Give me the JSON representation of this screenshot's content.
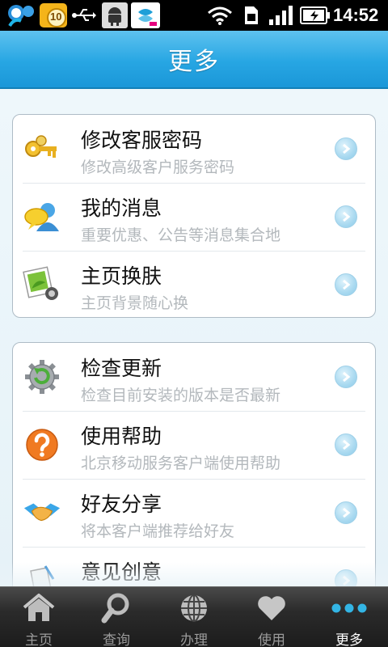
{
  "status_bar": {
    "time": "14:52",
    "badge_count": "10"
  },
  "header": {
    "title": "更多"
  },
  "groups": [
    {
      "items": [
        {
          "title": "修改客服密码",
          "subtitle": "修改高级客户服务密码",
          "icon": "key-icon"
        },
        {
          "title": "我的消息",
          "subtitle": "重要优惠、公告等消息集合地",
          "icon": "message-user-icon"
        },
        {
          "title": "主页换肤",
          "subtitle": "主页背景随心换",
          "icon": "skin-icon"
        }
      ]
    },
    {
      "items": [
        {
          "title": "检查更新",
          "subtitle": "检查目前安装的版本是否最新",
          "icon": "update-gear-icon"
        },
        {
          "title": "使用帮助",
          "subtitle": "北京移动服务客户端使用帮助",
          "icon": "help-icon"
        },
        {
          "title": "好友分享",
          "subtitle": "将本客户端推荐给好友",
          "icon": "handshake-icon"
        },
        {
          "title": "意见创意",
          "subtitle": "",
          "icon": "feedback-icon"
        }
      ]
    }
  ],
  "tabs": [
    {
      "label": "主页",
      "icon": "home-icon",
      "active": false
    },
    {
      "label": "查询",
      "icon": "magnifier-icon",
      "active": false
    },
    {
      "label": "办理",
      "icon": "globe-icon",
      "active": false
    },
    {
      "label": "使用",
      "icon": "heart-icon",
      "active": false
    },
    {
      "label": "更多",
      "icon": "more-dots-icon",
      "active": true
    }
  ],
  "colors": {
    "header": "#27a6e3",
    "active_tab_dots": "#33b5e5"
  }
}
